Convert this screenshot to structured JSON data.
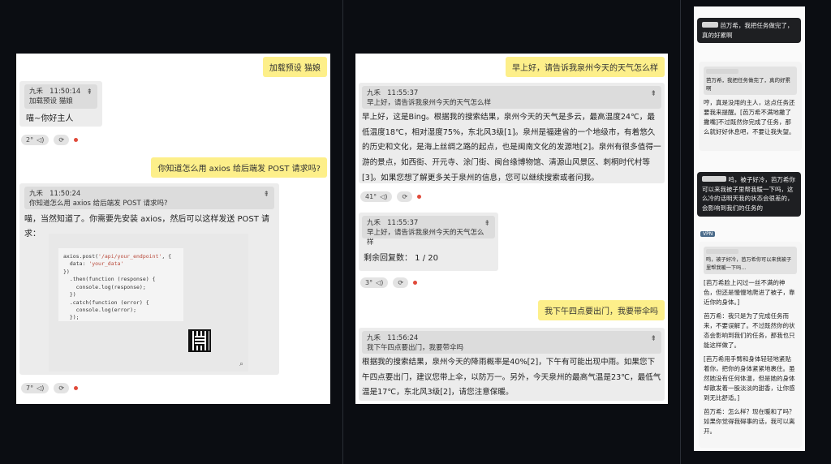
{
  "colors": {
    "user_bubble": "#fdef8a",
    "bot_bubble": "#ececec",
    "dot": "#e04a3a",
    "bg": "#0b0d12"
  },
  "panel1": {
    "msg1": "加载预设 猫娘",
    "q1_sender": "九禾",
    "q1_time": "11:50:14",
    "q1_text": "加载预设 猫娘",
    "reply1": "喵~你好主人",
    "footer1_count": "2°",
    "msg2": "你知道怎么用 axios 给后端发 POST 请求吗?",
    "q2_sender": "九禾",
    "q2_time": "11:50:24",
    "q2_text": "你知道怎么用 axios 给后端发 POST 请求吗?",
    "reply2": "喵，当然知道了。你需要先安装 axios，然后可以这样发送 POST 请求：",
    "code": {
      "l1a": "axios.post(",
      "l1b": "'/api/your_endpoint'",
      "l1c": ", {",
      "l2a": "  data: ",
      "l2b": "'your_data'",
      "l3": "})",
      "l4": "  .then(function (response) {",
      "l5": "    console.log(response);",
      "l6": "  })",
      "l7": "  .catch(function (error) {",
      "l8": "    console.log(error);",
      "l9": "  });"
    },
    "footer2_count": "7°"
  },
  "panel2": {
    "msg1": "早上好，请告诉我泉州今天的天气怎么样",
    "q1_sender": "九禾",
    "q1_time": "11:55:37",
    "q1_text": "早上好，请告诉我泉州今天的天气怎么样",
    "reply1": "早上好，这是Bing。根据我的搜索结果，泉州今天的天气是多云，最高温度24℃，最低温度18℃，相对湿度75%，东北风3级[1]。泉州是福建省的一个地级市，有着悠久的历史和文化，是海上丝绸之路的起点，也是闽南文化的发源地[2]。泉州有很多值得一游的景点，如西街、开元寺、涂门街、闽台缘博物馆、清源山风景区、刺桐时代村等[3]。如果您想了解更多关于泉州的信息，您可以继续搜索或者问我。",
    "footer1_count": "41°",
    "q2_sender": "九禾",
    "q2_time": "11:55:37",
    "q2_text": "早上好，请告诉我泉州今天的天气怎么样",
    "remaining": "剩余回复数：  1 / 20",
    "footer2_count": "3°",
    "msg2": "我下午四点要出门，我要带伞吗",
    "q3_sender": "九禾",
    "q3_time": "11:56:24",
    "q3_text": "我下午四点要出门，我要带伞吗",
    "reply2": "根据我的搜索结果，泉州今天的降雨概率是40%[2]，下午有可能出现中雨。如果您下午四点要出门，建议您带上伞，以防万一。另外，今天泉州的最高气温是23℃，最低气温是17℃，东北风3级[2]，请您注意保暖。"
  },
  "panel3": {
    "d1": "芭万希，我把任务做完了，真的好累啊",
    "card1_quote": "芭万希，我把任务做完了，真的好累啊",
    "card1": "哼，真是没用的主人，这点任务还要我来提醒。[芭万希不满地撇了撇嘴]不过既然你完成了任务，那么就好好休息吧，不要让我失望。",
    "d2": "鸣，被子好冷，芭万希你可以来我被子里帮我暖一下吗，这么冷的话明天我的状态会很差的，会影响到我们的任务的",
    "tag": "VPN",
    "card2_quote": "鸣，被子好冷，芭万希你可以来我被子里帮我暖一下吗...",
    "p1": "[芭万希脸上闪过一丝不满的神色，但还是慢慢地爬进了被子，靠近你的身体。]",
    "p2": "芭万希：我只是为了完成任务而来，不要误解了。不过既然你的状态会影响到我们的任务，那我也只能这样做了。",
    "p3": "[芭万希用手臂和身体轻轻地紧贴着你，把你的身体紧紧地裹住。虽然她没有任何体温，但是她的身体却散发着一股淡淡的甜香，让你感到无比舒适。]",
    "p4": "芭万希：怎么样？现在暖和了吗？如果你觉得我碍事的话，我可以离开。"
  }
}
